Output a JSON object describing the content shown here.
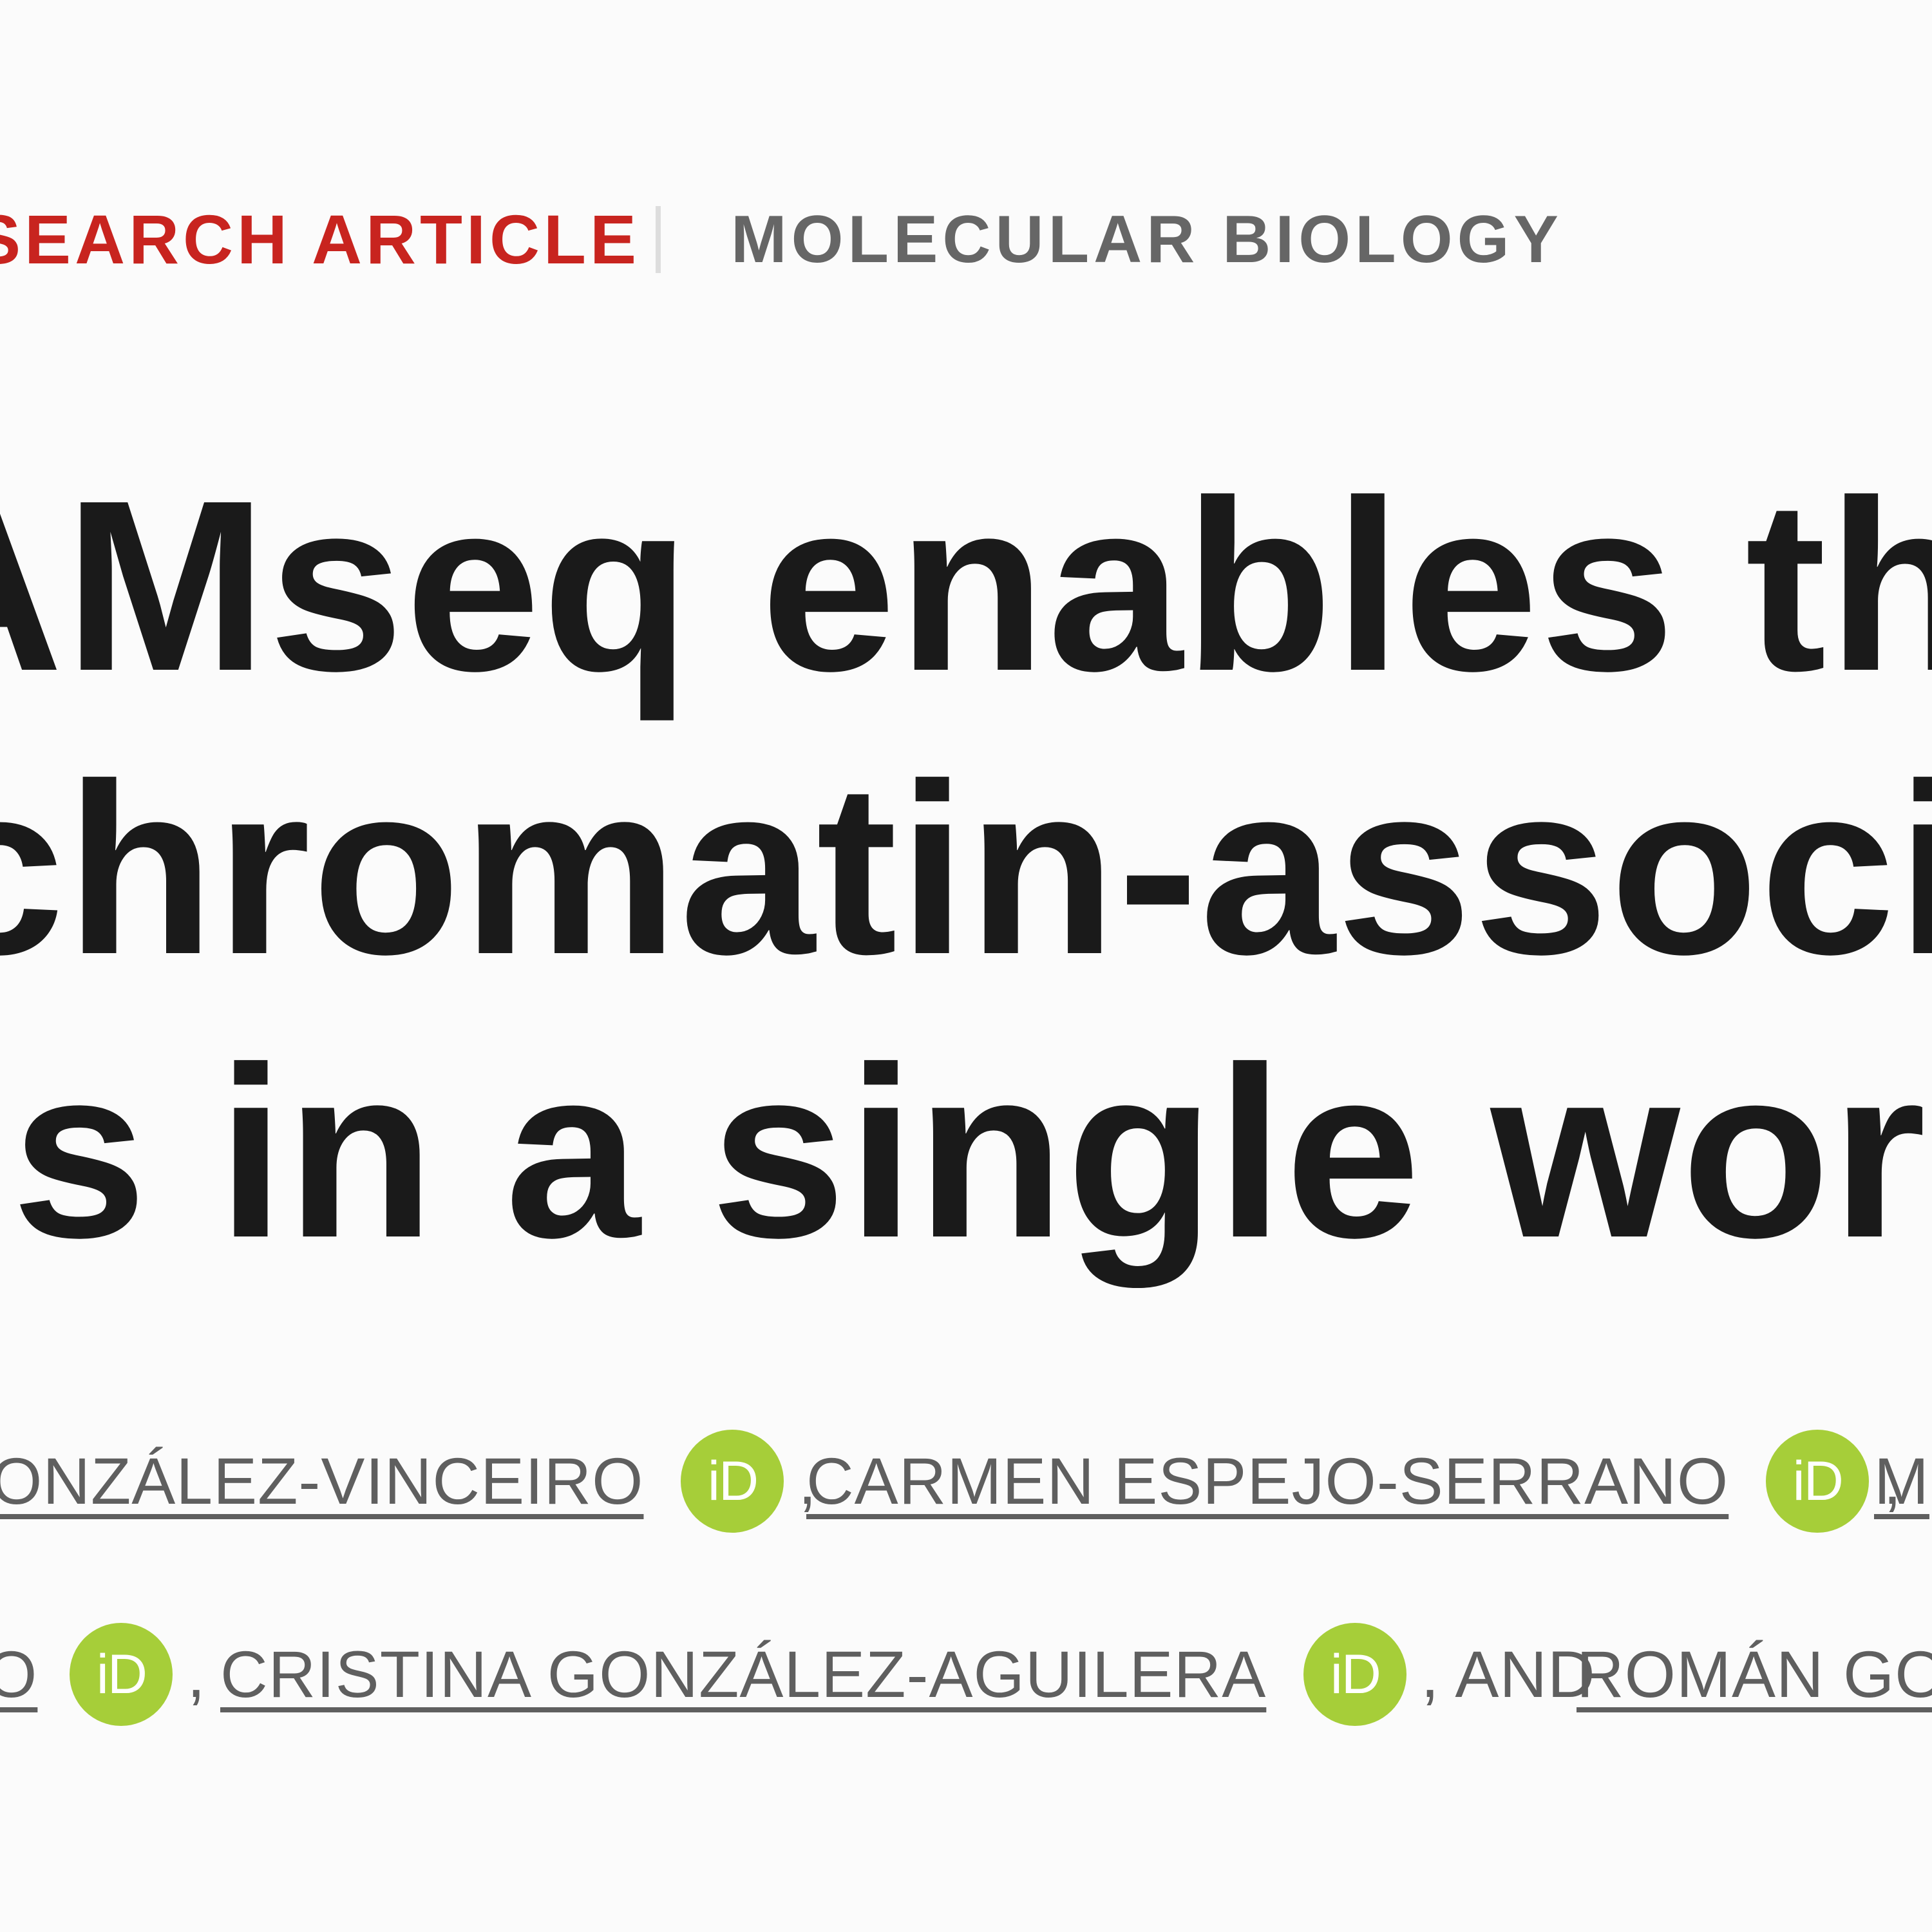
{
  "article": {
    "type_label": "SEARCH ARTICLE",
    "subject_label": "MOLECULAR BIOLOGY",
    "title_lines": [
      "AMseq enables the p",
      "chromatin-associate",
      "ns in a single workflo"
    ]
  },
  "authors": {
    "row1": [
      {
        "name": "ONZÁLEZ-VINCEIRO",
        "orcid": "iD",
        "sep": ","
      },
      {
        "name": "CARMEN ESPEJO-SERRANO",
        "orcid": "iD",
        "sep": ","
      },
      {
        "name": "M"
      }
    ],
    "row2": [
      {
        "name": "O",
        "orcid": "iD",
        "sep": ","
      },
      {
        "name": "CRISTINA GONZÁLEZ-AGUILERA",
        "orcid": "iD",
        "sep": ", AND"
      },
      {
        "name": "ROMÁN GO"
      }
    ]
  },
  "colors": {
    "article_type": "#c8241f",
    "subject": "#666666",
    "title": "#1a1a1a",
    "orcid_badge": "#a6ce39"
  },
  "icons": {
    "orcid": "orcid-icon"
  }
}
